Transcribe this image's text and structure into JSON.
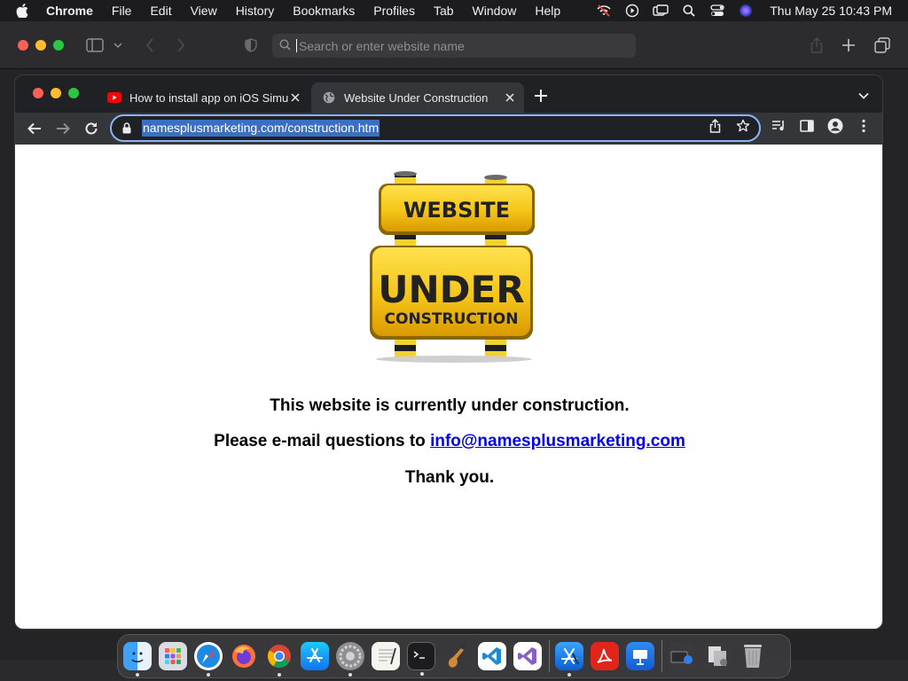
{
  "menubar": {
    "app_name": "Chrome",
    "items": [
      "File",
      "Edit",
      "View",
      "History",
      "Bookmarks",
      "Profiles",
      "Tab",
      "Window",
      "Help"
    ],
    "clock": "Thu May 25  10:43 PM"
  },
  "safari": {
    "search_placeholder": "Search or enter website name"
  },
  "chrome": {
    "tabs": [
      {
        "title": "How to install app on iOS Simu",
        "favicon": "youtube-icon",
        "active": false
      },
      {
        "title": "Website Under Construction",
        "favicon": "globe-icon",
        "active": true
      }
    ],
    "url": "namesplusmarketing.com/construction.htm"
  },
  "page": {
    "sign": {
      "top_text": "WEBSITE",
      "main_text": "UNDER",
      "sub_text": "CONSTRUCTION"
    },
    "line1": "This website is currently under construction.",
    "line2_prefix": "Please e-mail questions to ",
    "email": "info@namesplusmarketing.com",
    "line3": "Thank you."
  },
  "colors": {
    "accent_blue": "#8ab4f8",
    "link": "#0000ee",
    "sign_yellow": "#f5c518"
  },
  "dock": {
    "apps": [
      "finder-icon",
      "launchpad-icon",
      "safari-icon",
      "firefox-icon",
      "chrome-icon",
      "app-store-icon",
      "system-settings-icon",
      "textedit-icon",
      "terminal-icon",
      "garageband-icon",
      "vscode-icon",
      "visual-studio-icon",
      "xcode-icon",
      "acrobat-icon",
      "keynote-icon",
      "downloads-icon",
      "documents-icon",
      "trash-icon"
    ]
  }
}
